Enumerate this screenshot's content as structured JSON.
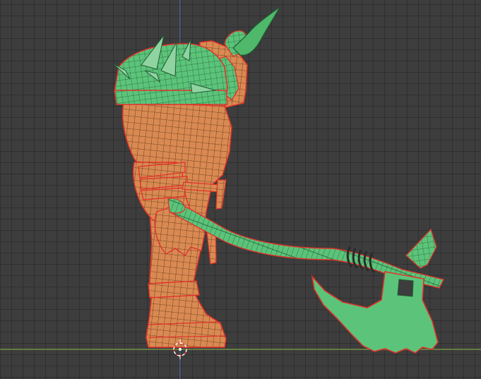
{
  "viewport": {
    "view": "side-orthographic",
    "mode": "edit-wireframe-overlay",
    "colors": {
      "background": "#3d3d3d",
      "grid": "#333333",
      "x_axis": "#7fa34a",
      "z_axis": "#4d6a9a",
      "skin": "#d98a52",
      "skin_wire": "#5a2e14",
      "armor": "#5cc47a",
      "armor_wire": "#1f5a33",
      "seam": "#e0322a",
      "cursor": "#ffffff"
    }
  },
  "objects": [
    {
      "name": "ogre-body",
      "material": "skin"
    },
    {
      "name": "spiked-shoulder-armor",
      "material": "armor"
    },
    {
      "name": "horned-helmet",
      "material": "armor"
    },
    {
      "name": "battle-axe",
      "material": "armor"
    }
  ],
  "icons": {
    "cursor": "3d-cursor-icon"
  }
}
